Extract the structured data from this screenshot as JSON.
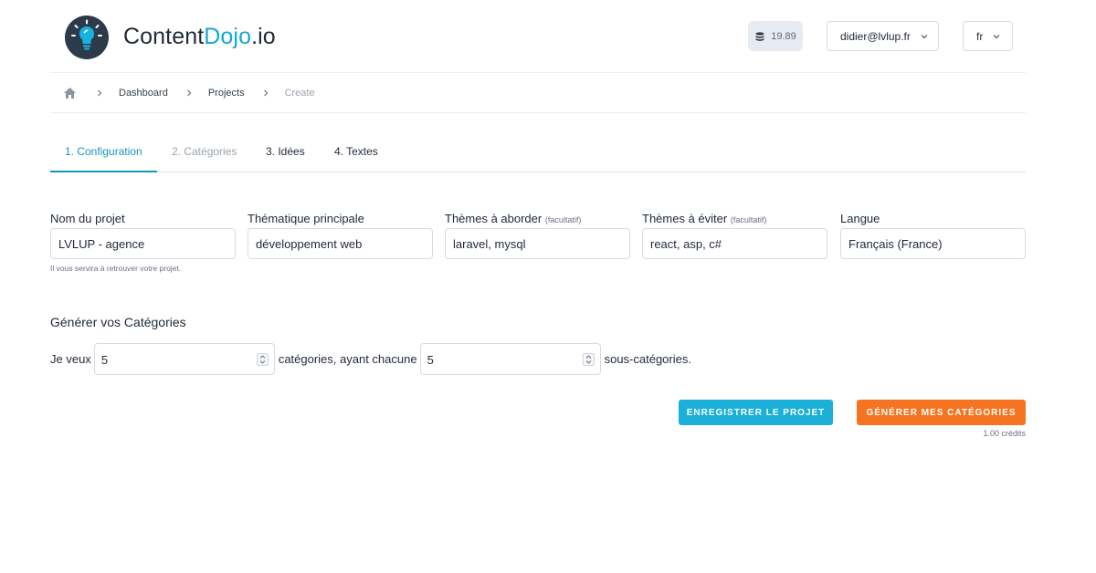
{
  "header": {
    "brand_primary": "Content",
    "brand_accent": "Dojo",
    "brand_suffix": ".io",
    "credits": "19.89",
    "user_email": "didier@lvlup.fr",
    "language": "fr",
    "colors": {
      "accent": "#12a8d4",
      "logo_bg": "#2d3a4a"
    }
  },
  "breadcrumb": {
    "items": [
      "Dashboard",
      "Projects",
      "Create"
    ]
  },
  "tabs": [
    {
      "label": "1. Configuration",
      "state": "active"
    },
    {
      "label": "2. Catégories",
      "state": "disabled"
    },
    {
      "label": "3. Idées",
      "state": "normal"
    },
    {
      "label": "4. Textes",
      "state": "normal"
    }
  ],
  "form": {
    "project_name": {
      "label": "Nom du projet",
      "value": "LVLUP - agence",
      "help": "Il vous servira à retrouver votre projet."
    },
    "main_theme": {
      "label": "Thématique principale",
      "value": "développement web"
    },
    "themes_include": {
      "label": "Thèmes à aborder",
      "hint": "(facultatif)",
      "value": "laravel, mysql"
    },
    "themes_avoid": {
      "label": "Thèmes à éviter",
      "hint": "(facultatif)",
      "value": "react, asp, c#"
    },
    "language": {
      "label": "Langue",
      "value": "Français (France)"
    }
  },
  "generate": {
    "title": "Générer vos Catégories",
    "prefix": "Je veux",
    "categories_count": "5",
    "middle": "catégories, ayant chacune",
    "subcategories_count": "5",
    "suffix": "sous-catégories."
  },
  "actions": {
    "save_label": "ENREGISTRER LE PROJET",
    "generate_label": "GÉNÉRER MES CATÉGORIES",
    "cost": "1.00 crédits",
    "colors": {
      "save": "#1ab0d8",
      "generate": "#f57421"
    }
  }
}
